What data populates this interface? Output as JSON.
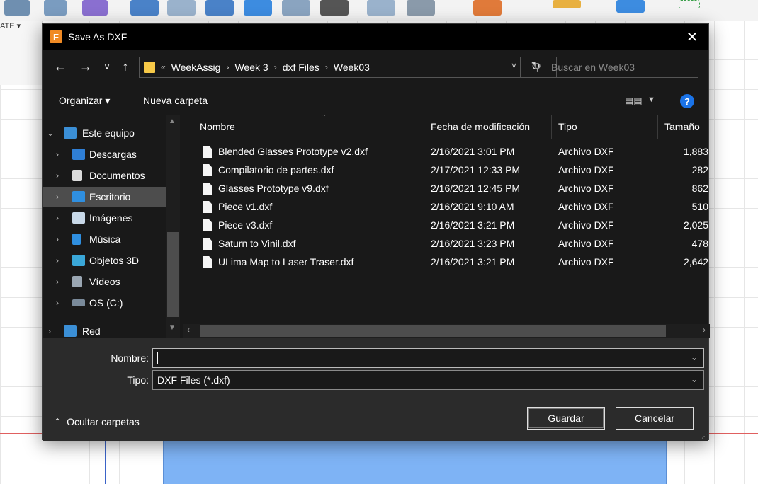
{
  "background": {
    "menu_label": "ATE ▾"
  },
  "dialog": {
    "title": "Save As DXF",
    "app_icon_letter": "F",
    "close_label": "✕"
  },
  "nav": {
    "back": "←",
    "forward": "→",
    "recent": "˅",
    "up": "↑",
    "breadcrumb_prefix": "«",
    "breadcrumb": [
      "WeekAssig",
      "Week 3",
      "dxf Files",
      "Week03"
    ],
    "separator": "›",
    "dropdown": "˅",
    "refresh": "↻",
    "search_placeholder": "Buscar en Week03",
    "search_icon": "⚲"
  },
  "commands": {
    "organize": "Organizar ▾",
    "new_folder": "Nueva carpeta",
    "view_icon": "▤▤",
    "view_dropdown": "▼",
    "help": "?"
  },
  "navpane": {
    "items": [
      {
        "label": "Este equipo",
        "icon": "computer-icon",
        "color": "#3b8fd6",
        "expanded": true
      },
      {
        "label": "Descargas",
        "icon": "download-icon",
        "color": "#2f7fd6"
      },
      {
        "label": "Documentos",
        "icon": "document-icon",
        "color": "#dcdcdc"
      },
      {
        "label": "Escritorio",
        "icon": "desktop-icon",
        "color": "#2f8fe0",
        "selected": true
      },
      {
        "label": "Imágenes",
        "icon": "pictures-icon",
        "color": "#c8d8e8"
      },
      {
        "label": "Música",
        "icon": "music-icon",
        "color": "#2f8fe0"
      },
      {
        "label": "Objetos 3D",
        "icon": "objects3d-icon",
        "color": "#3aa7d8"
      },
      {
        "label": "Vídeos",
        "icon": "videos-icon",
        "color": "#9aa6b2"
      },
      {
        "label": "OS (C:)",
        "icon": "drive-icon",
        "color": "#7a8a9a"
      },
      {
        "label": "Red",
        "icon": "network-icon",
        "color": "#3b8fd6"
      }
    ]
  },
  "table": {
    "columns": [
      "Nombre",
      "Fecha de modificación",
      "Tipo",
      "Tamaño"
    ],
    "rows": [
      {
        "name": "Blended Glasses Prototype v2.dxf",
        "date": "2/16/2021 3:01 PM",
        "type": "Archivo DXF",
        "size": "1,883"
      },
      {
        "name": "Compilatorio de partes.dxf",
        "date": "2/17/2021 12:33 PM",
        "type": "Archivo DXF",
        "size": "282"
      },
      {
        "name": "Glasses Prototype v9.dxf",
        "date": "2/16/2021 12:45 PM",
        "type": "Archivo DXF",
        "size": "862"
      },
      {
        "name": "Piece v1.dxf",
        "date": "2/16/2021 9:10 AM",
        "type": "Archivo DXF",
        "size": "510"
      },
      {
        "name": "Piece v3.dxf",
        "date": "2/16/2021 3:21 PM",
        "type": "Archivo DXF",
        "size": "2,025"
      },
      {
        "name": "Saturn to Vinil.dxf",
        "date": "2/16/2021 3:23 PM",
        "type": "Archivo DXF",
        "size": "478"
      },
      {
        "name": "ULima Map to Laser Traser.dxf",
        "date": "2/16/2021 3:21 PM",
        "type": "Archivo DXF",
        "size": "2,642"
      }
    ]
  },
  "form": {
    "name_label": "Nombre:",
    "name_value": "",
    "type_label": "Tipo:",
    "type_value": "DXF Files (*.dxf)",
    "hide_folders": "Ocultar carpetas",
    "save": "Guardar",
    "cancel": "Cancelar"
  }
}
